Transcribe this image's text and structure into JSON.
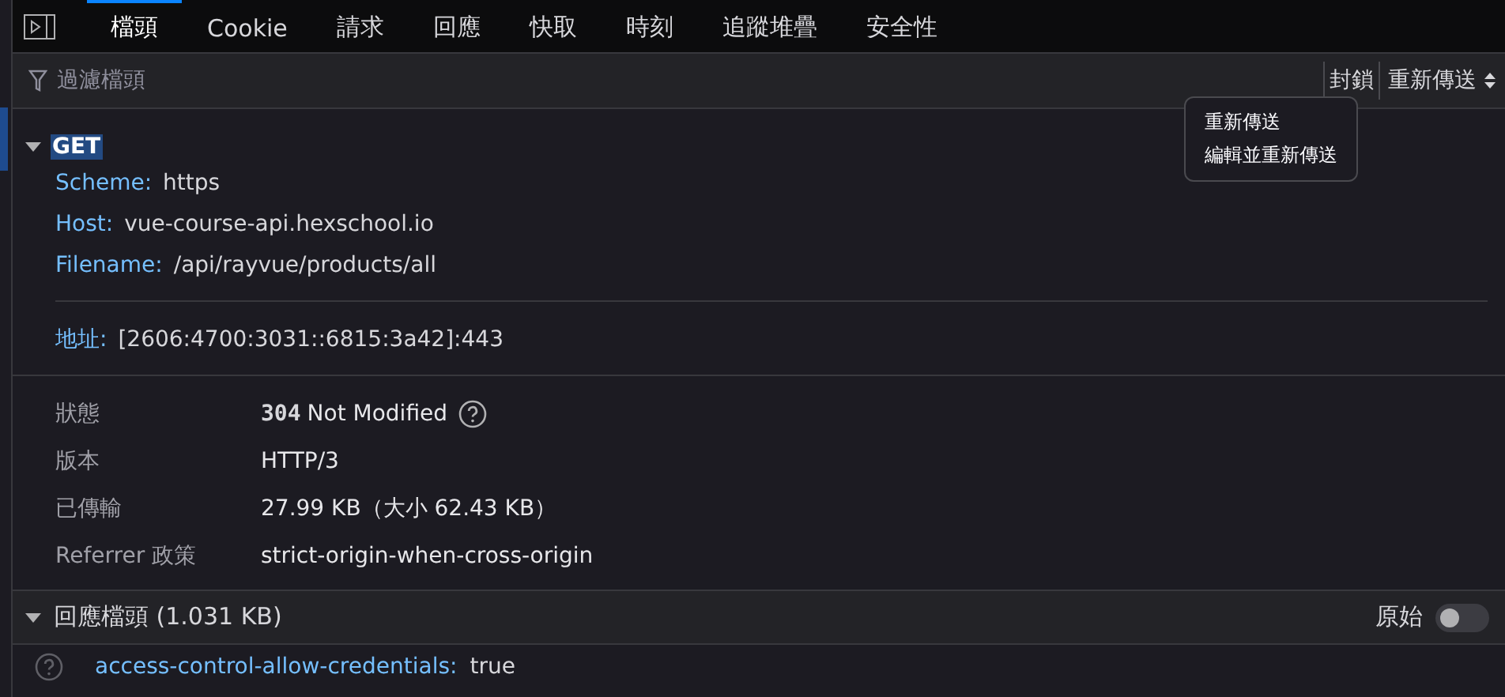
{
  "tabs": [
    {
      "label": "檔頭",
      "selected": true
    },
    {
      "label": "Cookie",
      "selected": false
    },
    {
      "label": "請求",
      "selected": false
    },
    {
      "label": "回應",
      "selected": false
    },
    {
      "label": "快取",
      "selected": false
    },
    {
      "label": "時刻",
      "selected": false
    },
    {
      "label": "追蹤堆疊",
      "selected": false
    },
    {
      "label": "安全性",
      "selected": false
    }
  ],
  "filter": {
    "placeholder": "過濾檔頭"
  },
  "toolbar": {
    "block": "封鎖",
    "resend": "重新傳送"
  },
  "menu": [
    "重新傳送",
    "編輯並重新傳送"
  ],
  "request": {
    "method": "GET",
    "expanded": true,
    "fields": [
      {
        "name": "Scheme:",
        "value": "https"
      },
      {
        "name": "Host:",
        "value": "vue-course-api.hexschool.io"
      },
      {
        "name": "Filename:",
        "value": "/api/rayvue/products/all"
      }
    ],
    "address": {
      "name": "地址:",
      "value": "[2606:4700:3031::6815:3a42]:443"
    }
  },
  "status_rows": [
    {
      "kind": "status",
      "label": "狀態",
      "code": "304",
      "value": "Not Modified"
    },
    {
      "kind": "text",
      "label": "版本",
      "value": "HTTP/3"
    },
    {
      "kind": "text",
      "label": "已傳輸",
      "value": "27.99 KB（大小 62.43 KB）"
    },
    {
      "kind": "text",
      "label": "Referrer 政策",
      "value": "strict-origin-when-cross-origin"
    }
  ],
  "response_headers": {
    "title": "回應檔頭 (1.031 KB)",
    "expanded": true,
    "raw_label": "原始",
    "raw_on": false,
    "headers": [
      {
        "name": "access-control-allow-credentials:",
        "value": "true"
      }
    ]
  }
}
